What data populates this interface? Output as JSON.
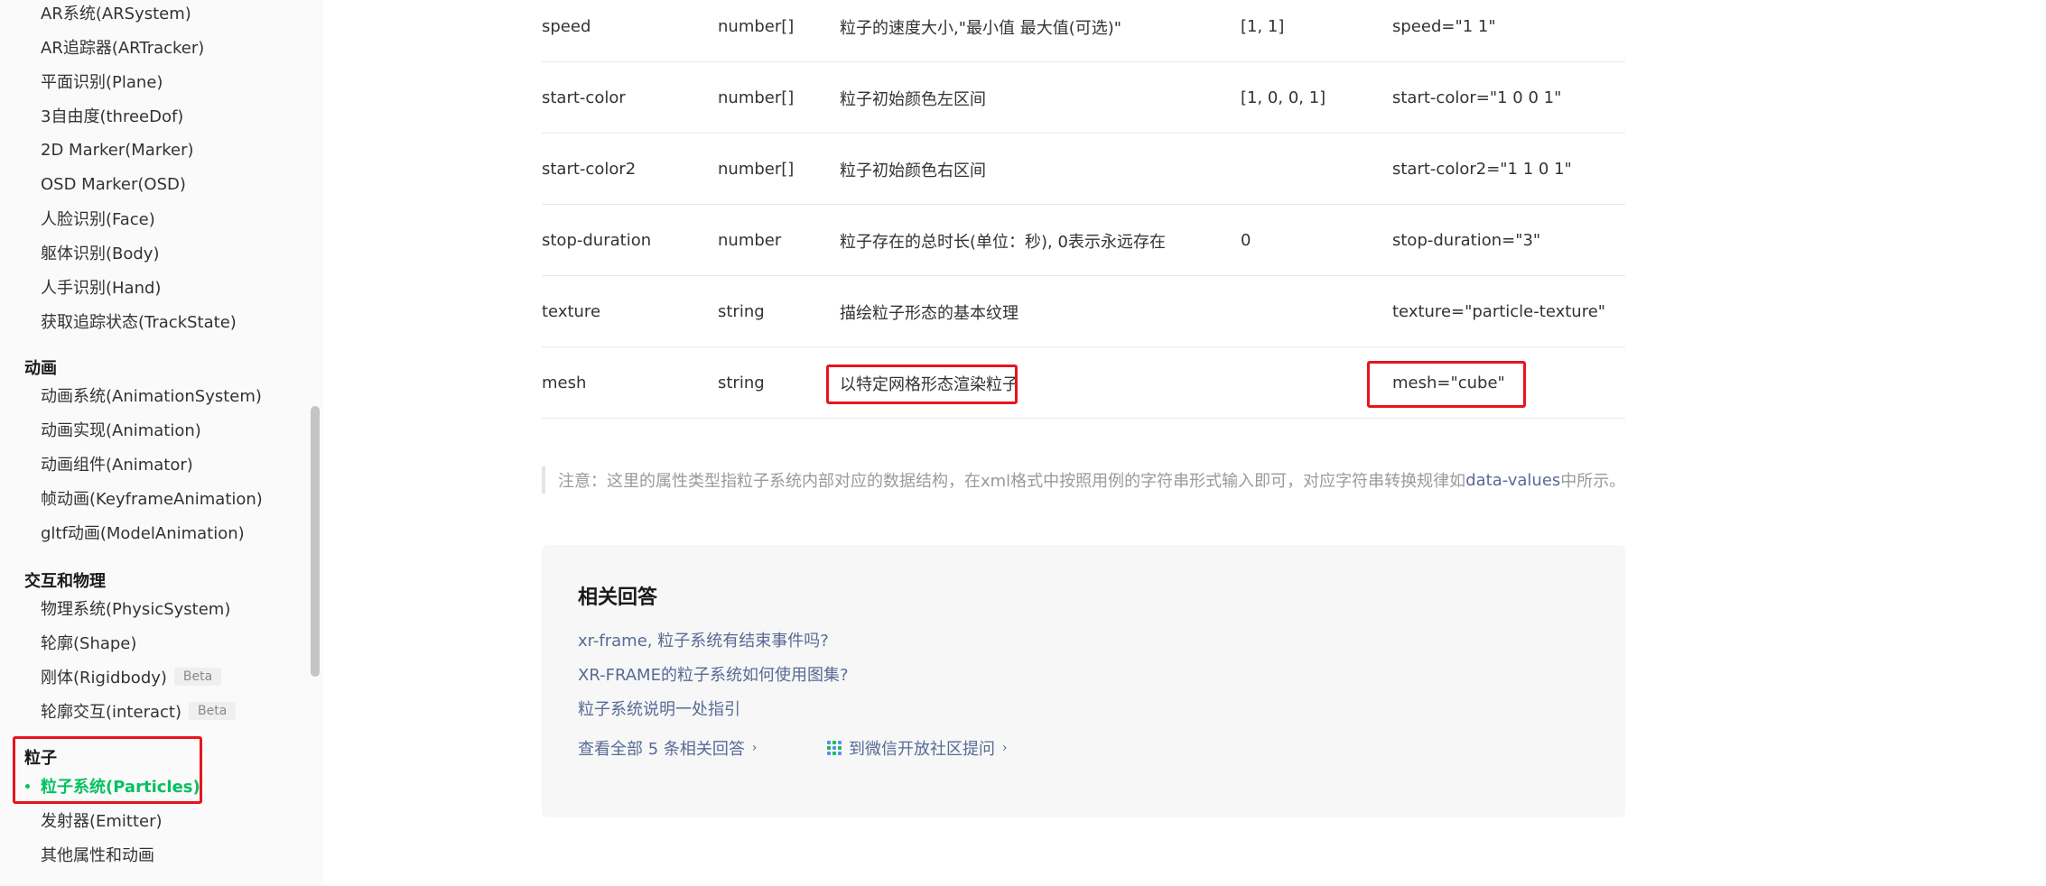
{
  "sidebar": {
    "groups": [
      {
        "title": "",
        "items": [
          {
            "label": "AR系统(ARSystem)"
          },
          {
            "label": "AR追踪器(ARTracker)"
          },
          {
            "label": "平面识别(Plane)"
          },
          {
            "label": "3自由度(threeDof)"
          },
          {
            "label": "2D Marker(Marker)"
          },
          {
            "label": "OSD Marker(OSD)"
          },
          {
            "label": "人脸识别(Face)"
          },
          {
            "label": "躯体识别(Body)"
          },
          {
            "label": "人手识别(Hand)"
          },
          {
            "label": "获取追踪状态(TrackState)"
          }
        ]
      },
      {
        "title": "动画",
        "items": [
          {
            "label": "动画系统(AnimationSystem)"
          },
          {
            "label": "动画实现(Animation)"
          },
          {
            "label": "动画组件(Animator)"
          },
          {
            "label": "帧动画(KeyframeAnimation)"
          },
          {
            "label": "gltf动画(ModelAnimation)"
          }
        ]
      },
      {
        "title": "交互和物理",
        "items": [
          {
            "label": "物理系统(PhysicSystem)"
          },
          {
            "label": "轮廓(Shape)"
          },
          {
            "label": "刚体(Rigidbody)",
            "badge": "Beta"
          },
          {
            "label": "轮廓交互(interact)",
            "badge": "Beta"
          }
        ]
      },
      {
        "title": "粒子",
        "items": [
          {
            "label": "粒子系统(Particles)",
            "active": true
          },
          {
            "label": "发射器(Emitter)"
          },
          {
            "label": "其他属性和动画"
          }
        ]
      }
    ]
  },
  "table": {
    "rows": [
      {
        "name": "speed",
        "type": "number[]",
        "desc": "粒子的速度大小,\"最小值 最大值(可选)\"",
        "default": "[1, 1]",
        "example": "speed=\"1 1\""
      },
      {
        "name": "start-color",
        "type": "number[]",
        "desc": "粒子初始颜色左区间",
        "default": "[1, 0, 0, 1]",
        "example": "start-color=\"1 0 0 1\""
      },
      {
        "name": "start-color2",
        "type": "number[]",
        "desc": "粒子初始颜色右区间",
        "default": "",
        "example": "start-color2=\"1 1 0 1\""
      },
      {
        "name": "stop-duration",
        "type": "number",
        "desc": "粒子存在的总时长(单位：秒), 0表示永远存在",
        "default": "0",
        "example": "stop-duration=\"3\""
      },
      {
        "name": "texture",
        "type": "string",
        "desc": "描绘粒子形态的基本纹理",
        "default": "",
        "example": "texture=\"particle-texture\""
      },
      {
        "name": "mesh",
        "type": "string",
        "desc": "以特定网格形态渲染粒子",
        "default": "",
        "example": "mesh=\"cube\""
      }
    ]
  },
  "note": {
    "prefix": "注意：这里的属性类型指粒子系统内部对应的数据结构，在xml格式中按照用例的字符串形式输入即可，对应字符串转换规律如",
    "link": "data-values",
    "suffix": "中所示。"
  },
  "related": {
    "title": "相关回答",
    "links": [
      "xr-frame, 粒子系统有结束事件吗?",
      "XR-FRAME的粒子系统如何使用图集?",
      "粒子系统说明一处指引"
    ],
    "view_all": "查看全部 5 条相关回答",
    "ask": "到微信开放社区提问"
  },
  "colors": {
    "accent_green": "#07c160",
    "link_blue": "#576b95",
    "highlight_red": "#e8141c"
  }
}
